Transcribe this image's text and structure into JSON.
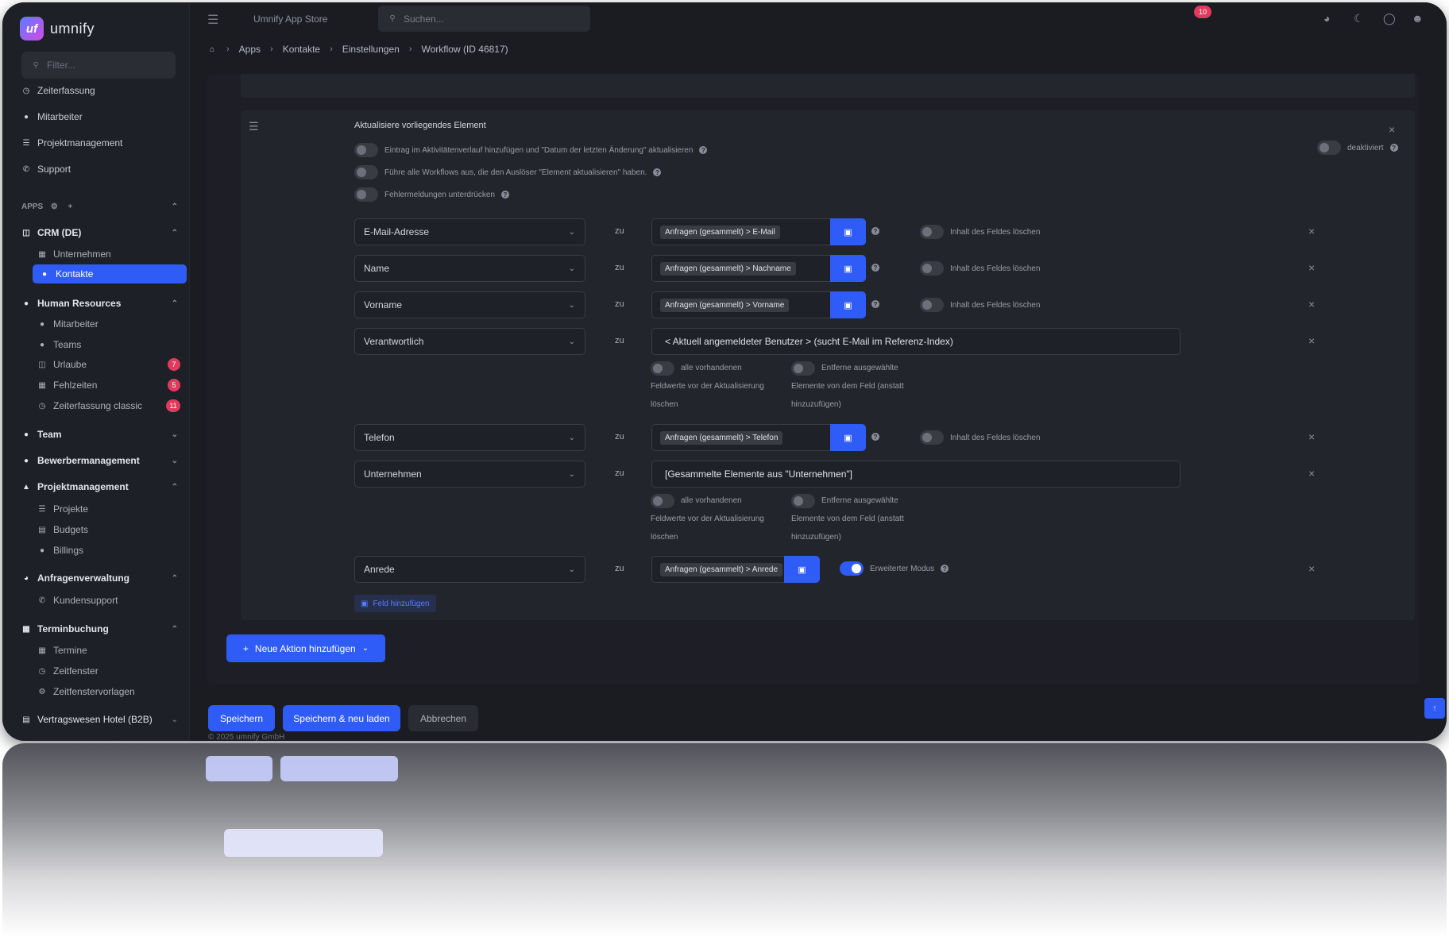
{
  "app": {
    "brand": "umnify",
    "logo_glyph": "uf"
  },
  "sidebar": {
    "filter_placeholder": "Filter...",
    "top_items": [
      {
        "label": "Zeiterfassung",
        "icon": "clock-icon"
      },
      {
        "label": "Mitarbeiter",
        "icon": "users-icon"
      },
      {
        "label": "Projektmanagement",
        "icon": "list-icon"
      },
      {
        "label": "Support",
        "icon": "phone-icon"
      }
    ],
    "apps_label": "APPS",
    "crm": {
      "label": "CRM (DE)",
      "items": [
        "Unternehmen",
        "Kontakte"
      ]
    },
    "hr": {
      "label": "Human Resources",
      "items": [
        {
          "label": "Mitarbeiter"
        },
        {
          "label": "Teams"
        },
        {
          "label": "Urlaube",
          "badge": "7"
        },
        {
          "label": "Fehlzeiten",
          "badge": "5"
        },
        {
          "label": "Zeiterfassung classic",
          "badge": "11"
        }
      ]
    },
    "team": "Team",
    "bewerber": "Bewerbermanagement",
    "pm": {
      "label": "Projektmanagement",
      "items": [
        "Projekte",
        "Budgets",
        "Billings"
      ]
    },
    "anfragen": {
      "label": "Anfragenverwaltung",
      "items": [
        "Kundensupport"
      ]
    },
    "termin": {
      "label": "Terminbuchung",
      "items": [
        "Termine",
        "Zeitfenster",
        "Zeitfenstervorlagen"
      ]
    },
    "vertrag": "Vertragswesen Hotel (B2B)"
  },
  "topbar": {
    "store_label": "Umnify App Store",
    "search_placeholder": "Suchen...",
    "notifications": "10"
  },
  "breadcrumb": [
    "Apps",
    "Kontakte",
    "Einstellungen",
    "Workflow (ID 46817)"
  ],
  "action": {
    "title": "Aktualisiere vorliegendes Element",
    "options": [
      "Eintrag im Aktivitätenverlauf hinzufügen und \"Datum der letzten Änderung\" aktualisieren",
      "Führe alle Workflows aus, die den Auslöser \"Element aktualisieren\" haben.",
      "Fehlermeldungen unterdrücken"
    ],
    "deactivated_label": "deaktiviert",
    "to_label": "zu",
    "clear_label": "Inhalt des Feldes löschen",
    "rows": [
      {
        "field": "E-Mail-Adresse",
        "value": "Anfragen (gesammelt) > E-Mail"
      },
      {
        "field": "Name",
        "value": "Anfragen (gesammelt) > Nachname"
      },
      {
        "field": "Vorname",
        "value": "Anfragen (gesammelt) > Vorname"
      },
      {
        "field": "Verantwortlich",
        "value": "< Aktuell angemeldeter Benutzer > (sucht E-Mail im Referenz-Index)"
      },
      {
        "field": "Telefon",
        "value": "Anfragen (gesammelt) > Telefon"
      },
      {
        "field": "Unternehmen",
        "value": "[Gesammelte Elemente aus \"Unternehmen\"]"
      },
      {
        "field": "Anrede",
        "value": "Anfragen (gesammelt) > Anrede"
      }
    ],
    "sub_left_title": "alle vorhandenen",
    "sub_left_text": [
      "Feldwerte vor der Aktualisierung",
      "löschen"
    ],
    "sub_right_title": "Entferne ausgewählte",
    "sub_right_text": [
      "Elemente von dem Feld (anstatt",
      "hinzuzufügen)"
    ],
    "advanced_label": "Erweiterter Modus",
    "add_field": "Feld hinzufügen"
  },
  "new_action": "Neue Aktion hinzufügen",
  "buttons": {
    "save": "Speichern",
    "save_reload": "Speichern & neu laden",
    "cancel": "Abbrechen"
  },
  "footer": "© 2025 umnify GmbH",
  "colors": {
    "accent": "#2f5cf6",
    "badge": "#e23a5c",
    "background": "#1b1c22"
  }
}
